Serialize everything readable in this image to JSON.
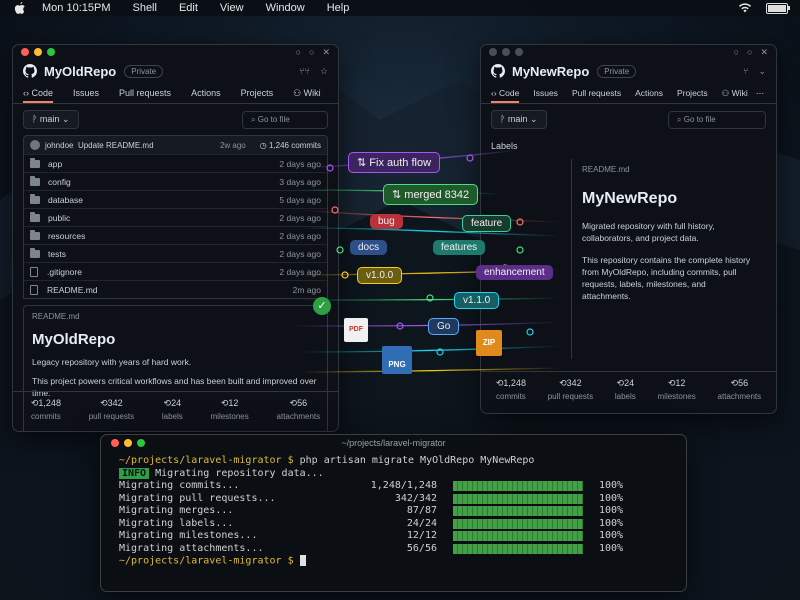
{
  "menubar": {
    "time": "Mon 10:15PM",
    "items": [
      "Shell",
      "Edit",
      "View",
      "Window",
      "Help"
    ],
    "battery_level": 0.9
  },
  "old_repo": {
    "name": "MyOldRepo",
    "visibility": "Private",
    "tabs": [
      "Code",
      "Issues",
      "Pull requests",
      "Actions",
      "Projects",
      "Wiki"
    ],
    "branch": "main",
    "search_placeholder": "Go to file",
    "commit": {
      "author": "johndoe",
      "message": "Update README.md",
      "time": "2w ago",
      "count": "1,246 commits"
    },
    "files": [
      {
        "name": "app",
        "type": "folder",
        "age": "2 days ago"
      },
      {
        "name": "config",
        "type": "folder",
        "age": "3 days ago"
      },
      {
        "name": "database",
        "type": "folder",
        "age": "5 days ago"
      },
      {
        "name": "public",
        "type": "folder",
        "age": "2 days ago"
      },
      {
        "name": "resources",
        "type": "folder",
        "age": "2 days ago"
      },
      {
        "name": "tests",
        "type": "folder",
        "age": "2 days ago"
      },
      {
        "name": ".gitignore",
        "type": "file",
        "age": "2 days ago"
      },
      {
        "name": "README.md",
        "type": "file",
        "age": "2m ago"
      }
    ],
    "readme_label": "README.md",
    "readme_title": "MyOldRepo",
    "readme_p1": "Legacy repository with years of hard work.",
    "readme_p2": "This project powers critical workflows and has been built and improved over time.",
    "stats": [
      {
        "n": "1,248",
        "label": "commits"
      },
      {
        "n": "342",
        "label": "pull requests"
      },
      {
        "n": "24",
        "label": "labels"
      },
      {
        "n": "12",
        "label": "milestones"
      },
      {
        "n": "56",
        "label": "attachments"
      }
    ]
  },
  "new_repo": {
    "name": "MyNewRepo",
    "visibility": "Private",
    "tabs": [
      "Code",
      "Issues",
      "Pull requests",
      "Actions",
      "Projects",
      "Wiki"
    ],
    "branch": "main",
    "search_placeholder": "Go to file",
    "labels_header": "Labels",
    "readme_label": "README.md",
    "readme_title": "MyNewRepo",
    "readme_p1": "Migrated repository with full history, collaborators, and project data.",
    "readme_p2": "This repository contains the complete history from MyOldRepo, including commits, pull requests, labels, milestones, and attachments.",
    "stats": [
      {
        "n": "1,248",
        "label": "commits"
      },
      {
        "n": "342",
        "label": "pull requests"
      },
      {
        "n": "24",
        "label": "labels"
      },
      {
        "n": "12",
        "label": "milestones"
      },
      {
        "n": "56",
        "label": "attachments"
      }
    ]
  },
  "pills": {
    "fix_auth": "Fix auth flow",
    "merged": "merged 8342",
    "bug": "bug",
    "feature": "feature",
    "docs": "docs",
    "features": "features",
    "v100": "v1.0.0",
    "enhancement": "enhancement",
    "v110": "v1.1.0",
    "go": "Go",
    "pdf": "PDF",
    "zip": "ZIP",
    "png": "PNG"
  },
  "colors": {
    "pill_purple": "#6b3fa0",
    "pill_green": "#2f7d3a",
    "pill_red": "#b8323a",
    "pill_teal": "#1f7a6e",
    "pill_blue": "#2d4f8a",
    "pill_yellow": "#8a7a1c",
    "accent_orange": "#f78166"
  },
  "terminal": {
    "title": "~/projects/laravel-migrator",
    "prompt": "~/projects/laravel-migrator $",
    "command": "php artisan migrate MyOldRepo MyNewRepo",
    "info_tag": "INFO",
    "info_text": "Migrating repository data...",
    "rows": [
      {
        "label": "Migrating commits...",
        "count": "1,248/1,248",
        "progress": 100,
        "pct": "100%"
      },
      {
        "label": "Migrating pull requests...",
        "count": "342/342",
        "progress": 100,
        "pct": "100%"
      },
      {
        "label": "Migrating merges...",
        "count": "87/87",
        "progress": 100,
        "pct": "100%"
      },
      {
        "label": "Migrating labels...",
        "count": "24/24",
        "progress": 100,
        "pct": "100%"
      },
      {
        "label": "Migrating milestones...",
        "count": "12/12",
        "progress": 100,
        "pct": "100%"
      },
      {
        "label": "Migrating attachments...",
        "count": "56/56",
        "progress": 100,
        "pct": "100%"
      }
    ],
    "final_prompt": "~/projects/laravel-migrator $"
  }
}
